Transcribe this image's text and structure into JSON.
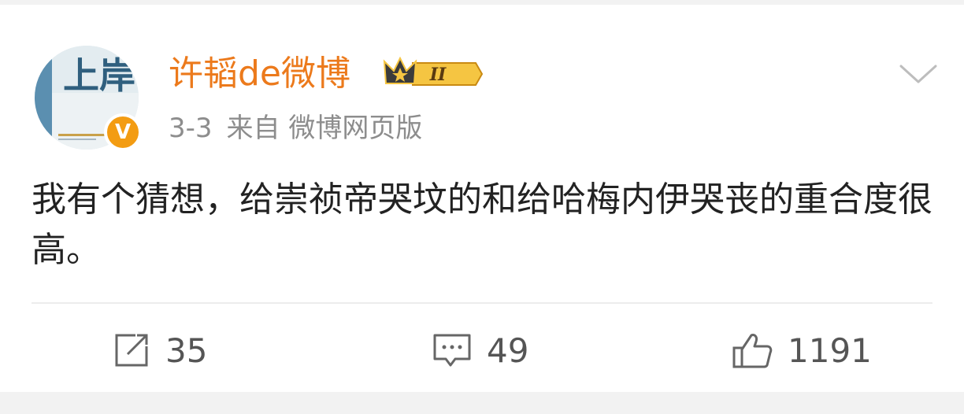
{
  "post": {
    "username": "许韬de微博",
    "vip_level": "II",
    "avatar": {
      "text": "上岸"
    },
    "verified_label": "V",
    "date": "3-3",
    "source": "来自 微博网页版",
    "content": "我有个猜想，给崇祯帝哭坟的和给哈梅内伊哭丧的重合度很高。"
  },
  "actions": {
    "repost_count": "35",
    "comment_count": "49",
    "like_count": "1191"
  },
  "colors": {
    "username": "#ec7a1c",
    "meta": "#8d8d8d",
    "text": "#222222",
    "verified": "#f39c12",
    "badge_gold": "#f5c542"
  },
  "icons": [
    "more-chevron-icon",
    "repost-icon",
    "comment-icon",
    "like-icon",
    "crown-icon"
  ]
}
